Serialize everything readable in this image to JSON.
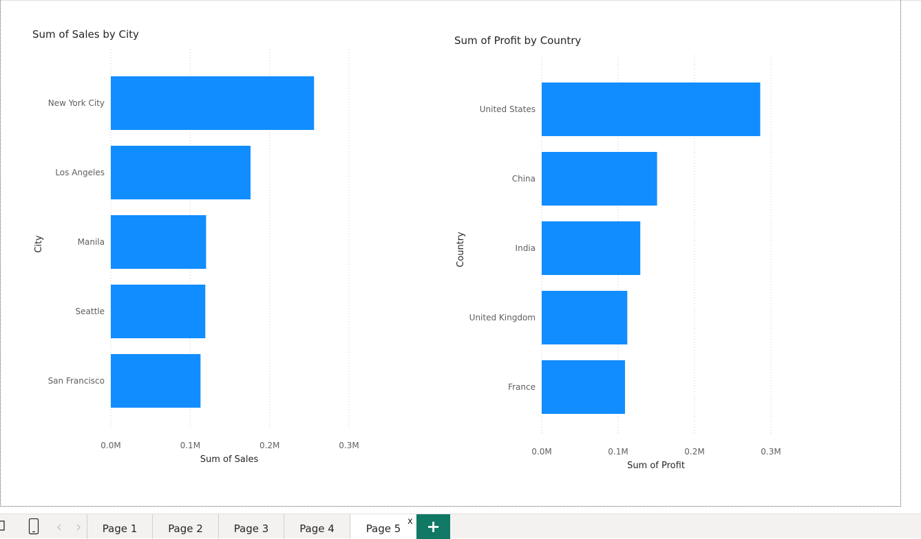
{
  "charts": [
    {
      "title": "Sum of Sales by City",
      "xlabel": "Sum of Sales",
      "ylabel": "City"
    },
    {
      "title": "Sum of Profit by Country",
      "xlabel": "Sum of Profit",
      "ylabel": "Country"
    }
  ],
  "chart_data": [
    {
      "type": "bar",
      "orientation": "horizontal",
      "title": "Sum of Sales by City",
      "xlabel": "Sum of Sales",
      "ylabel": "City",
      "categories": [
        "New York City",
        "Los Angeles",
        "Manila",
        "Seattle",
        "San Francisco"
      ],
      "values": [
        0.256,
        0.176,
        0.12,
        0.119,
        0.113
      ],
      "unit": "M",
      "xlim": [
        0,
        0.3
      ],
      "ticks": [
        "0.0M",
        "0.1M",
        "0.2M",
        "0.3M"
      ],
      "color": "#118dff",
      "grid": true
    },
    {
      "type": "bar",
      "orientation": "horizontal",
      "title": "Sum of Profit by Country",
      "xlabel": "Sum of Profit",
      "ylabel": "Country",
      "categories": [
        "United States",
        "China",
        "India",
        "United Kingdom",
        "France"
      ],
      "values": [
        0.286,
        0.151,
        0.129,
        0.112,
        0.109
      ],
      "unit": "M",
      "xlim": [
        0,
        0.3
      ],
      "ticks": [
        "0.0M",
        "0.1M",
        "0.2M",
        "0.3M"
      ],
      "color": "#118dff",
      "grid": true
    }
  ],
  "tabs": [
    {
      "label": "Page 1",
      "active": false
    },
    {
      "label": "Page 2",
      "active": false
    },
    {
      "label": "Page 3",
      "active": false
    },
    {
      "label": "Page 4",
      "active": false
    },
    {
      "label": "Page 5",
      "active": true
    }
  ],
  "tab_close_label": "x",
  "add_page_label": "+",
  "icons": {
    "desktop": "desktop-layout-icon",
    "mobile": "mobile-layout-icon",
    "prev": "chevron-left-icon",
    "next": "chevron-right-icon"
  }
}
